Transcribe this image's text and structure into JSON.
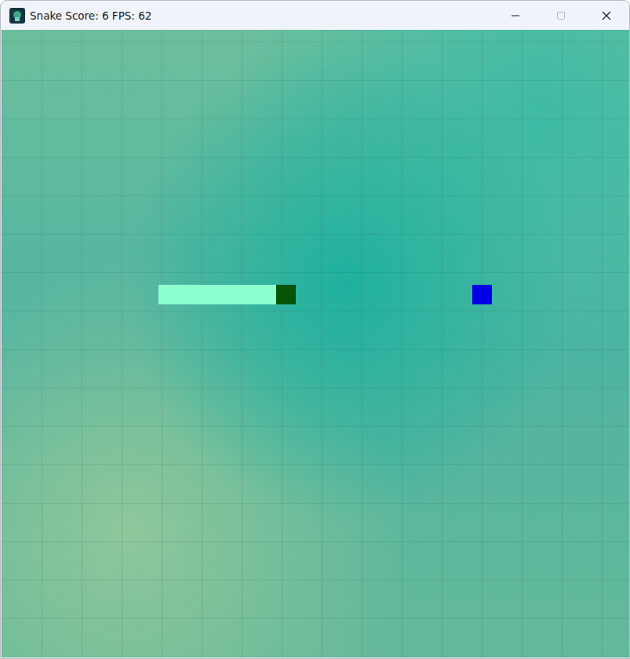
{
  "window": {
    "title": "Snake Score: 6 FPS: 62",
    "maximize_disabled": true
  },
  "board": {
    "cols": 32,
    "rows": 32
  },
  "snake": [
    {
      "col": 8,
      "row": 13,
      "kind": "body"
    },
    {
      "col": 9,
      "row": 13,
      "kind": "body"
    },
    {
      "col": 10,
      "row": 13,
      "kind": "body"
    },
    {
      "col": 11,
      "row": 13,
      "kind": "body"
    },
    {
      "col": 12,
      "row": 13,
      "kind": "body"
    },
    {
      "col": 13,
      "row": 13,
      "kind": "body"
    },
    {
      "col": 14,
      "row": 13,
      "kind": "head"
    }
  ],
  "food": {
    "col": 24,
    "row": 13
  }
}
